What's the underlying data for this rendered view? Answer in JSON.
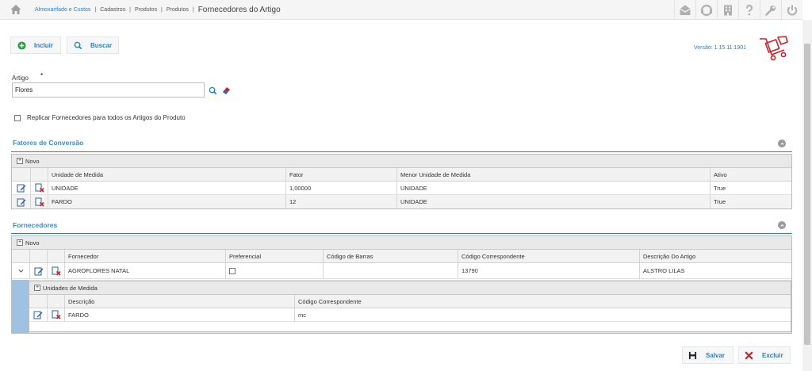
{
  "breadcrumb": {
    "items": [
      "Almoxarifado e Custos",
      "Cadastros",
      "Produtos",
      "Produtos"
    ],
    "current": "Fornecedores do Artigo"
  },
  "top_icons": [
    "inbox-icon",
    "support-icon",
    "building-icon",
    "help-icon",
    "wrench-icon",
    "power-icon"
  ],
  "toolbar": {
    "incluir_label": "Incluir",
    "buscar_label": "Buscar"
  },
  "version": "Versão: 1.15.11.1901",
  "artigo": {
    "label": "Artigo",
    "required_mark": "*",
    "value": "Flores"
  },
  "replicar": {
    "label": "Replicar Fornecedores para todos os Artigos do Produto",
    "checked": false
  },
  "fatores": {
    "title": "Fatores de Conversão",
    "novo_label": "Novo",
    "columns": [
      "Unidade de Medida",
      "Fator",
      "Menor Unidade de Medida",
      "Ativo"
    ],
    "rows": [
      [
        "UNIDADE",
        "1,00000",
        "UNIDADE",
        "True"
      ],
      [
        "FARDO",
        "12",
        "UNIDADE",
        "True"
      ]
    ]
  },
  "fornecedores": {
    "title": "Fornecedores",
    "novo_label": "Novo",
    "columns": [
      "Fornecedor",
      "Preferencial",
      "Código de Barras",
      "Código Correspondente",
      "Descrição Do Artigo"
    ],
    "rows": [
      [
        "AGROFLORES NATAL",
        "",
        "",
        "13790",
        "ALSTRO LILAS"
      ]
    ],
    "sub": {
      "title": "Unidades de Medida",
      "columns": [
        "Descrição",
        "Código Correspondente"
      ],
      "rows": [
        [
          "FARDO",
          "mc"
        ]
      ]
    }
  },
  "footer": {
    "salvar_label": "Salvar",
    "excluir_label": "Excluir"
  },
  "colors": {
    "accent": "#2f7fb5",
    "section_title": "#3a8cc4",
    "delete": "#c0262c",
    "add": "#2e9e3e"
  }
}
